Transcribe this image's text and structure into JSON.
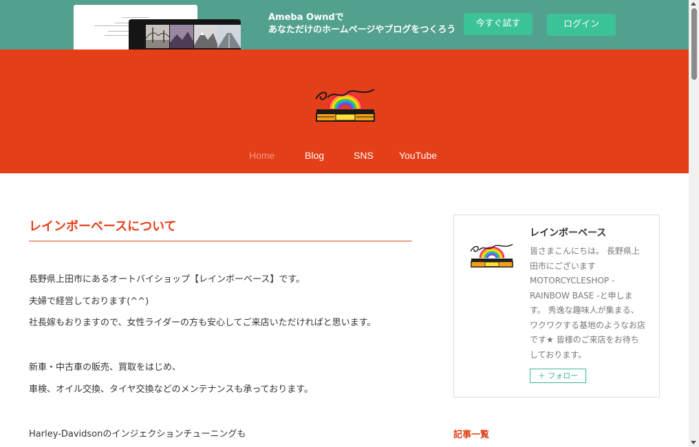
{
  "banner": {
    "line1": "Ameba Owndで",
    "line2": "あなただけのホームページやブログをつくろう",
    "try_button": "今すぐ試す",
    "login_button": "ログイン"
  },
  "header": {
    "nav": [
      {
        "label": "Home"
      },
      {
        "label": "Blog"
      },
      {
        "label": "SNS"
      },
      {
        "label": "YouTube"
      }
    ]
  },
  "article": {
    "title": "レインボーベースについて",
    "paragraphs": [
      "長野県上田市にあるオートバイショップ【レインボーベース】です。",
      "夫婦で経営しております(^^)",
      "社長嫁もおりますので、女性ライダーの方も安心してご来店いただければと思います。",
      "新車・中古車の販売、買取をはじめ、",
      "車検、オイル交換、タイヤ交換などのメンテナンスも承っております。",
      "Harley-Davidsonのインジェクションチューニングも"
    ]
  },
  "sidebar": {
    "profile": {
      "name": "レインボーベース",
      "description": [
        "皆さまこんにちは。 長野県上",
        "田市にございます",
        "MOTORCYCLESHOP -",
        "RAINBOW BASE -と申しま",
        "す。 秀逸な趣味人が集まる、",
        "ワクワクする基地のようなお店",
        "です★ 皆様のご来店をお待ち",
        "しております。"
      ],
      "follow_button": "＋ フォロー"
    },
    "recent_heading": "記事一覧"
  },
  "colors": {
    "brand_red": "#e53f19",
    "banner_green": "#52a18e",
    "button_green": "#3cc298",
    "follow_teal": "#3cb19a"
  }
}
